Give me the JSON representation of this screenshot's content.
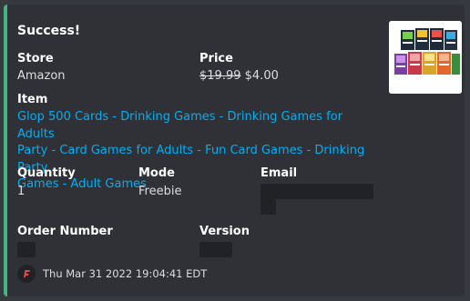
{
  "embed": {
    "accent_color": "#43b581",
    "title": "Success!",
    "fields": {
      "store": {
        "name": "Store",
        "value": "Amazon"
      },
      "price": {
        "name": "Price",
        "original": "$19.99",
        "current": "$4.00"
      },
      "item": {
        "name": "Item",
        "links": [
          "Glop 500 Cards - Drinking Games - Drinking Games for Adults",
          "Party - Card Games for Adults - Fun Card Games - Drinking Party",
          "Games - Adult Games"
        ]
      },
      "quantity": {
        "name": "Quantity",
        "value": "1"
      },
      "mode": {
        "name": "Mode",
        "value": "Freebie"
      },
      "email": {
        "name": "Email",
        "value_redacted": true
      },
      "order_number": {
        "name": "Order Number",
        "value_redacted": true
      },
      "version": {
        "name": "Version",
        "value_redacted": true
      }
    },
    "thumbnail": {
      "icon": "product-box-icon"
    },
    "footer": {
      "icon": "bot-logo-icon",
      "timestamp": "Thu Mar 31 2022 19:04:41 EDT"
    }
  }
}
